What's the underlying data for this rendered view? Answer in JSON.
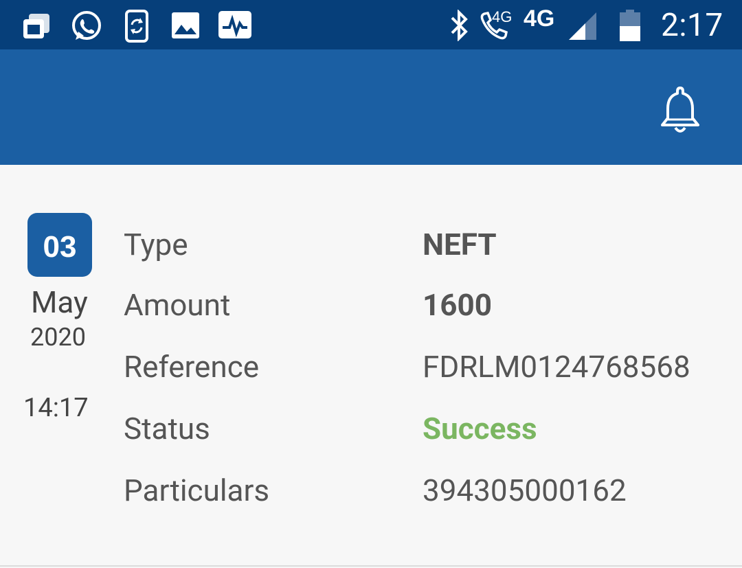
{
  "status_bar": {
    "clock": "2:17",
    "network_label": "4G",
    "call_network_label": "4G",
    "icons": [
      "notes-icon",
      "whatsapp-icon",
      "phone-sync-icon",
      "gallery-icon",
      "activity-icon",
      "bluetooth-icon",
      "volte-call-icon",
      "signal-icon",
      "battery-icon"
    ]
  },
  "transaction": {
    "day": "03",
    "month": "May",
    "year": "2020",
    "time": "14:17",
    "rows": [
      {
        "label": "Type",
        "value": "NEFT"
      },
      {
        "label": "Amount",
        "value": "1600"
      },
      {
        "label": "Reference",
        "value": "FDRLM0124768568"
      },
      {
        "label": "Status",
        "value": "Success"
      },
      {
        "label": "Particulars",
        "value": "394305000162"
      }
    ]
  },
  "colors": {
    "status_bar": "#063f7a",
    "app_bar": "#1b5fa3",
    "success": "#7bb661"
  }
}
